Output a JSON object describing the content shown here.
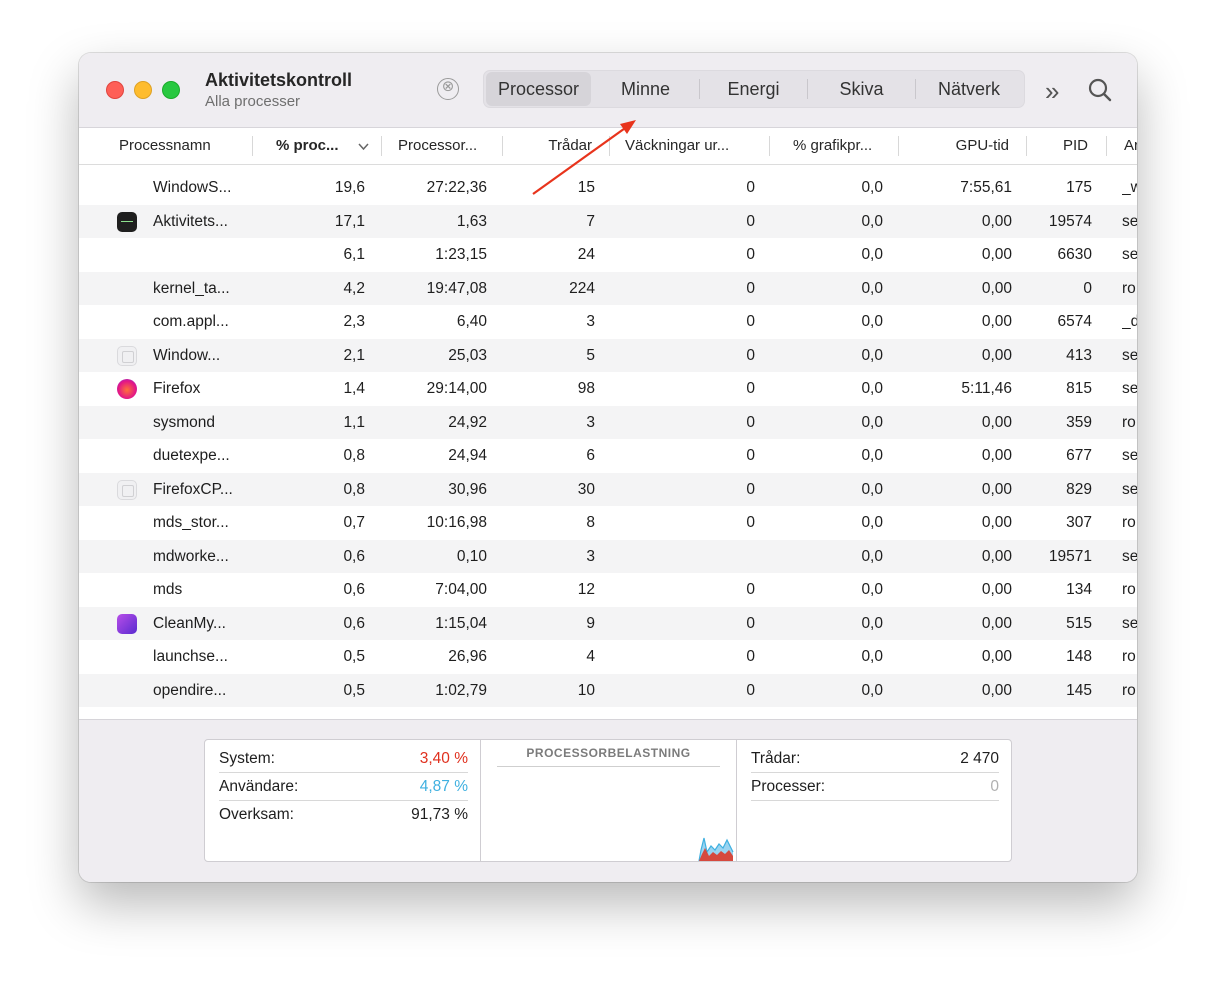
{
  "window": {
    "title": "Aktivitetskontroll",
    "subtitle": "Alla processer"
  },
  "toolbar": {
    "stop_label": "⊗",
    "tabs": [
      {
        "label": "Processor",
        "active": true
      },
      {
        "label": "Minne",
        "active": false
      },
      {
        "label": "Energi",
        "active": false
      },
      {
        "label": "Skiva",
        "active": false
      },
      {
        "label": "Nätverk",
        "active": false
      }
    ],
    "more_label": "»"
  },
  "table": {
    "columns": [
      "Processnamn",
      "% proc...",
      "Processor...",
      "Trådar",
      "Väckningar ur...",
      "% grafikpr...",
      "GPU-tid",
      "PID",
      "Ar"
    ],
    "rows": [
      {
        "icon": "",
        "name": "WindowS...",
        "cpu": "19,6",
        "cpu_time": "27:22,36",
        "threads": "15",
        "wakeups": "0",
        "gpu_pct": "0,0",
        "gpu_time": "7:55,61",
        "pid": "175",
        "user": "_w"
      },
      {
        "icon": "activity-monitor-icon",
        "name": "Aktivitets...",
        "cpu": "17,1",
        "cpu_time": "1,63",
        "threads": "7",
        "wakeups": "0",
        "gpu_pct": "0,0",
        "gpu_time": "0,00",
        "pid": "19574",
        "user": "se"
      },
      {
        "icon": "",
        "name": "",
        "cpu": "6,1",
        "cpu_time": "1:23,15",
        "threads": "24",
        "wakeups": "0",
        "gpu_pct": "0,0",
        "gpu_time": "0,00",
        "pid": "6630",
        "user": "se"
      },
      {
        "icon": "",
        "name": "kernel_ta...",
        "cpu": "4,2",
        "cpu_time": "19:47,08",
        "threads": "224",
        "wakeups": "0",
        "gpu_pct": "0,0",
        "gpu_time": "0,00",
        "pid": "0",
        "user": "ro"
      },
      {
        "icon": "",
        "name": "com.appl...",
        "cpu": "2,3",
        "cpu_time": "6,40",
        "threads": "3",
        "wakeups": "0",
        "gpu_pct": "0,0",
        "gpu_time": "0,00",
        "pid": "6574",
        "user": "_d"
      },
      {
        "icon": "window-icon",
        "name": "Window...",
        "cpu": "2,1",
        "cpu_time": "25,03",
        "threads": "5",
        "wakeups": "0",
        "gpu_pct": "0,0",
        "gpu_time": "0,00",
        "pid": "413",
        "user": "se"
      },
      {
        "icon": "firefox-icon",
        "name": "Firefox",
        "cpu": "1,4",
        "cpu_time": "29:14,00",
        "threads": "98",
        "wakeups": "0",
        "gpu_pct": "0,0",
        "gpu_time": "5:11,46",
        "pid": "815",
        "user": "se"
      },
      {
        "icon": "",
        "name": "sysmond",
        "cpu": "1,1",
        "cpu_time": "24,92",
        "threads": "3",
        "wakeups": "0",
        "gpu_pct": "0,0",
        "gpu_time": "0,00",
        "pid": "359",
        "user": "ro"
      },
      {
        "icon": "",
        "name": "duetexpe...",
        "cpu": "0,8",
        "cpu_time": "24,94",
        "threads": "6",
        "wakeups": "0",
        "gpu_pct": "0,0",
        "gpu_time": "0,00",
        "pid": "677",
        "user": "se"
      },
      {
        "icon": "window-icon",
        "name": "FirefoxCP...",
        "cpu": "0,8",
        "cpu_time": "30,96",
        "threads": "30",
        "wakeups": "0",
        "gpu_pct": "0,0",
        "gpu_time": "0,00",
        "pid": "829",
        "user": "se"
      },
      {
        "icon": "",
        "name": "mds_stor...",
        "cpu": "0,7",
        "cpu_time": "10:16,98",
        "threads": "8",
        "wakeups": "0",
        "gpu_pct": "0,0",
        "gpu_time": "0,00",
        "pid": "307",
        "user": "ro"
      },
      {
        "icon": "",
        "name": "mdworke...",
        "cpu": "0,6",
        "cpu_time": "0,10",
        "threads": "3",
        "wakeups": "",
        "gpu_pct": "0,0",
        "gpu_time": "0,00",
        "pid": "19571",
        "user": "se"
      },
      {
        "icon": "",
        "name": "mds",
        "cpu": "0,6",
        "cpu_time": "7:04,00",
        "threads": "12",
        "wakeups": "0",
        "gpu_pct": "0,0",
        "gpu_time": "0,00",
        "pid": "134",
        "user": "ro"
      },
      {
        "icon": "cleanmymac-icon",
        "name": "CleanMy...",
        "cpu": "0,6",
        "cpu_time": "1:15,04",
        "threads": "9",
        "wakeups": "0",
        "gpu_pct": "0,0",
        "gpu_time": "0,00",
        "pid": "515",
        "user": "se"
      },
      {
        "icon": "",
        "name": "launchse...",
        "cpu": "0,5",
        "cpu_time": "26,96",
        "threads": "4",
        "wakeups": "0",
        "gpu_pct": "0,0",
        "gpu_time": "0,00",
        "pid": "148",
        "user": "ro"
      },
      {
        "icon": "",
        "name": "opendire...",
        "cpu": "0,5",
        "cpu_time": "1:02,79",
        "threads": "10",
        "wakeups": "0",
        "gpu_pct": "0,0",
        "gpu_time": "0,00",
        "pid": "145",
        "user": "ro"
      }
    ]
  },
  "stats": {
    "system_label": "System:",
    "system_value": "3,40 %",
    "system_color": "#e0301e",
    "user_label": "Användare:",
    "user_value": "4,87 %",
    "user_color": "#3fb0e0",
    "idle_label": "Overksam:",
    "idle_value": "91,73 %",
    "graph_title": "PROCESSORBELASTNING",
    "threads_label": "Trådar:",
    "threads_value": "2 470",
    "processes_label": "Processer:",
    "processes_value": "0"
  },
  "colors": {
    "annotation_arrow": "#e8341c",
    "toolbar_bg": "#efedf1"
  }
}
